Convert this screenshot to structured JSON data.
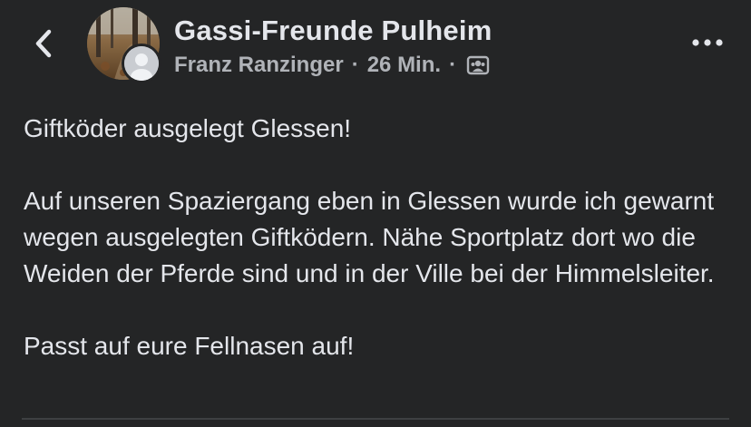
{
  "header": {
    "back_icon": "chevron-left-icon",
    "group_name": "Gassi-Freunde Pulheim",
    "author": "Franz Ranzinger",
    "separator": "·",
    "time": "26 Min.",
    "privacy_icon": "group-members-icon",
    "more_icon": "more-horizontal-icon"
  },
  "post": {
    "paragraphs": [
      "Giftköder ausgelegt Glessen!",
      "Auf unseren Spaziergang eben in Glessen wurde ich gewarnt wegen ausgelegten Giftködern. Nähe Sportplatz dort wo die Weiden der Pferde sind und in der Ville bei der Himmelsleiter.",
      "Passt auf eure Fellnasen auf!"
    ]
  },
  "colors": {
    "background": "#242526",
    "primary_text": "#e4e6eb",
    "secondary_text": "#b0b3b8"
  }
}
